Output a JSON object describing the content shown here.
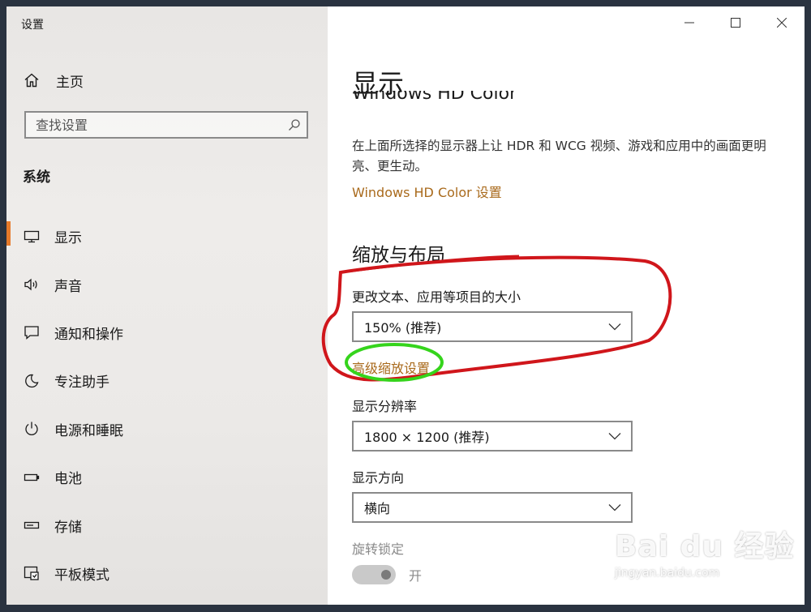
{
  "window": {
    "title": "设置"
  },
  "sidebar": {
    "home_label": "主页",
    "search_placeholder": "查找设置",
    "section_title": "系统",
    "items": [
      {
        "label": "显示",
        "icon": "monitor-icon",
        "active": true
      },
      {
        "label": "声音",
        "icon": "speaker-icon",
        "active": false
      },
      {
        "label": "通知和操作",
        "icon": "notification-icon",
        "active": false
      },
      {
        "label": "专注助手",
        "icon": "moon-icon",
        "active": false
      },
      {
        "label": "电源和睡眠",
        "icon": "power-icon",
        "active": false
      },
      {
        "label": "电池",
        "icon": "battery-icon",
        "active": false
      },
      {
        "label": "存储",
        "icon": "storage-icon",
        "active": false
      },
      {
        "label": "平板模式",
        "icon": "tablet-mode-icon",
        "active": false
      }
    ]
  },
  "main": {
    "page_title": "显示",
    "hd_heading_clipped": "Windows HD Color",
    "hd_description": "在上面所选择的显示器上让 HDR 和 WCG 视频、游戏和应用中的画面更明亮、更生动。",
    "hd_link": "Windows HD Color 设置",
    "scale_section": "缩放与布局",
    "scale_label": "更改文本、应用等项目的大小",
    "scale_value": "150% (推荐)",
    "advanced_scaling_link": "高级缩放设置",
    "resolution_label": "显示分辨率",
    "resolution_value": "1800 × 1200 (推荐)",
    "orientation_label": "显示方向",
    "orientation_value": "横向",
    "rotation_lock_label": "旋转锁定",
    "rotation_lock_state": "开"
  },
  "watermark": {
    "brand": "Bai du 经验",
    "url": "jingyan.baidu.com"
  },
  "colors": {
    "accent": "#e67a2a",
    "link": "#a96a1c",
    "annotation_red": "#d0161b",
    "annotation_green": "#35d41c"
  }
}
